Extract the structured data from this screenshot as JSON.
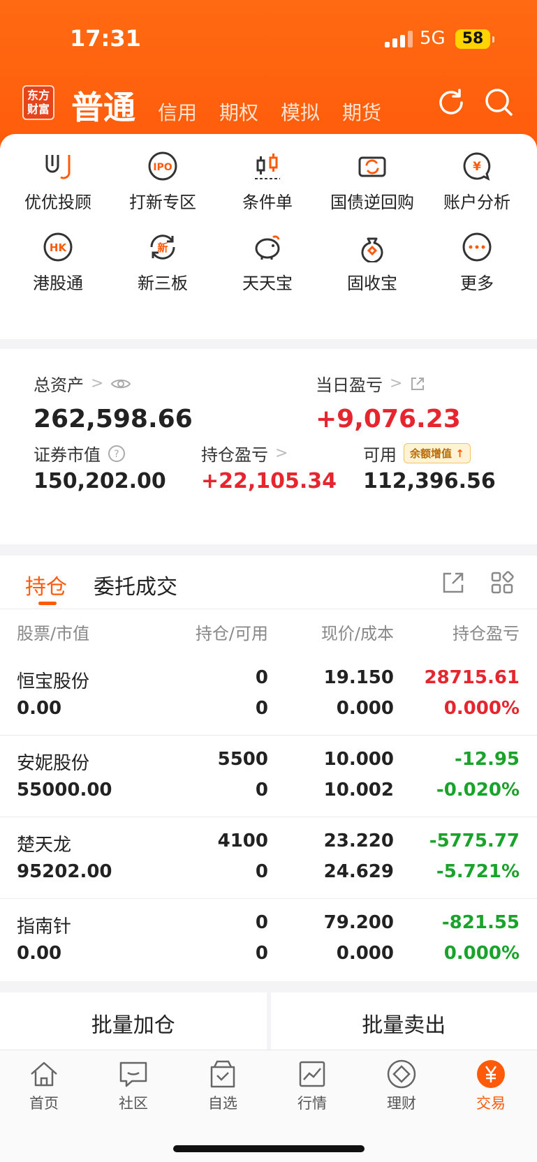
{
  "status": {
    "time": "17:31",
    "network": "5G",
    "battery": "58"
  },
  "header": {
    "logo_text": "东方财富",
    "account_types": [
      "普通",
      "信用",
      "期权",
      "模拟",
      "期货"
    ]
  },
  "quick_menu": [
    {
      "label": "优优投顾",
      "icon": "advisor-icon"
    },
    {
      "label": "打新专区",
      "icon": "ipo-icon",
      "icon_text": "IPO"
    },
    {
      "label": "条件单",
      "icon": "candlestick-icon"
    },
    {
      "label": "国债逆回购",
      "icon": "repo-icon"
    },
    {
      "label": "账户分析",
      "icon": "yen-chat-icon",
      "icon_text": "¥"
    },
    {
      "label": "港股通",
      "icon": "hk-icon",
      "icon_text": "HK"
    },
    {
      "label": "新三板",
      "icon": "new-board-icon",
      "icon_text": "新"
    },
    {
      "label": "天天宝",
      "icon": "piggy-bank-icon"
    },
    {
      "label": "固收宝",
      "icon": "money-bag-icon"
    },
    {
      "label": "更多",
      "icon": "more-icon"
    }
  ],
  "assets": {
    "total_label": "总资产",
    "total_value": "262,598.66",
    "daily_label": "当日盈亏",
    "daily_value": "+9,076.23",
    "market_label": "证券市值",
    "market_value": "150,202.00",
    "position_pl_label": "持仓盈亏",
    "position_pl_value": "+22,105.34",
    "available_label": "可用",
    "available_badge": "余额增值",
    "available_value": "112,396.56"
  },
  "holdings": {
    "tabs": [
      "持仓",
      "委托成交"
    ],
    "columns": [
      "股票/市值",
      "持仓/可用",
      "现价/成本",
      "持仓盈亏"
    ],
    "rows": [
      {
        "name": "恒宝股份",
        "market_value": "0.00",
        "position": "0",
        "available": "0",
        "price": "19.150",
        "cost": "0.000",
        "pl": "28715.61",
        "pl_pct": "0.000%",
        "dir": "up"
      },
      {
        "name": "安妮股份",
        "market_value": "55000.00",
        "position": "5500",
        "available": "0",
        "price": "10.000",
        "cost": "10.002",
        "pl": "-12.95",
        "pl_pct": "-0.020%",
        "dir": "down"
      },
      {
        "name": "楚天龙",
        "market_value": "95202.00",
        "position": "4100",
        "available": "0",
        "price": "23.220",
        "cost": "24.629",
        "pl": "-5775.77",
        "pl_pct": "-5.721%",
        "dir": "down"
      },
      {
        "name": "指南针",
        "market_value": "0.00",
        "position": "0",
        "available": "0",
        "price": "79.200",
        "cost": "0.000",
        "pl": "-821.55",
        "pl_pct": "0.000%",
        "dir": "down"
      }
    ]
  },
  "actions": {
    "batch_add": "批量加仓",
    "batch_sell": "批量卖出"
  },
  "nav": [
    {
      "label": "首页",
      "icon": "home-icon"
    },
    {
      "label": "社区",
      "icon": "community-icon"
    },
    {
      "label": "自选",
      "icon": "watchlist-icon"
    },
    {
      "label": "行情",
      "icon": "market-icon"
    },
    {
      "label": "理财",
      "icon": "wealth-icon"
    },
    {
      "label": "交易",
      "icon": "trade-icon"
    }
  ],
  "colors": {
    "brand": "#ff5a0a",
    "up": "#e6262e",
    "down": "#1aa32a"
  }
}
